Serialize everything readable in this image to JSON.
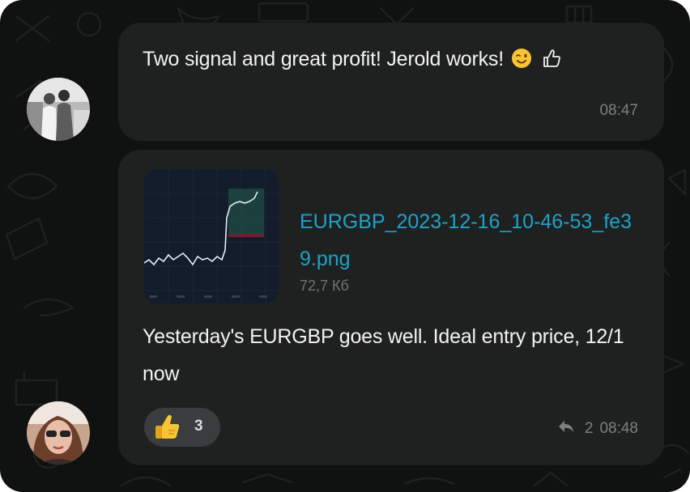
{
  "messages": [
    {
      "text": "Two signal and great profit! Jerold works!",
      "emojis": [
        "winking-face",
        "thumbs-up-outline"
      ],
      "time": "08:47"
    },
    {
      "attachment": {
        "file_name": "EURGBP_2023-12-16_10-46-53_fe39.png",
        "file_size": "72,7 Кб"
      },
      "text": "Yesterday's EURGBP goes well. Ideal entry price, 12/1 now",
      "reaction": {
        "emoji": "thumbs-up",
        "count": "3"
      },
      "reply_count": "2",
      "time": "08:48"
    }
  ],
  "colors": {
    "background": "#101212",
    "bubble": "#1f2121",
    "text": "#f2f2f2",
    "link": "#1da2c9",
    "muted": "#7b7f80",
    "reaction_pill": "#3a3d3e"
  }
}
